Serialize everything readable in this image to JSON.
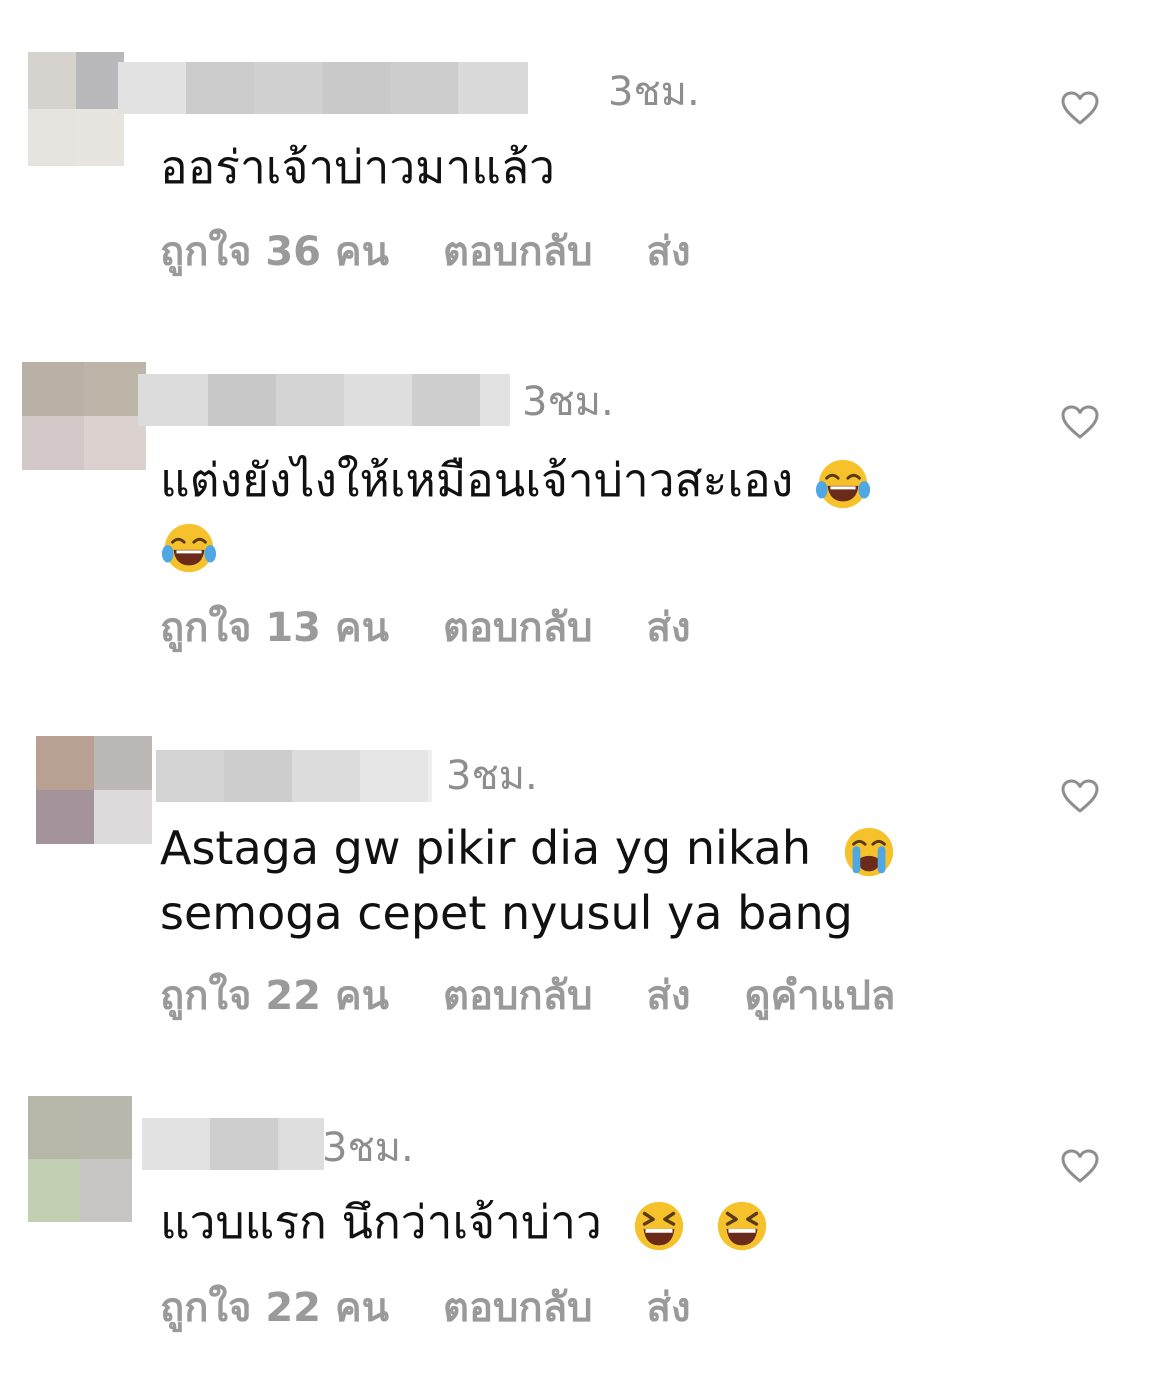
{
  "comments": [
    {
      "time": "3ชม.",
      "text": "ออร่าเจ้าบ่าวมาแล้ว",
      "likes": "ถูกใจ 36 คน",
      "reply": "ตอบกลับ",
      "send": "ส่ง",
      "emojis": []
    },
    {
      "time": "3ชม.",
      "text": "แต่งยังไงให้เหมือนเจ้าบ่าวสะเอง",
      "likes": "ถูกใจ 13 คน",
      "reply": "ตอบกลับ",
      "send": "ส่ง",
      "emojis": [
        "face-with-tears-of-joy",
        "face-with-tears-of-joy"
      ]
    },
    {
      "time": "3ชม.",
      "text": "Astaga gw pikir dia yg nikah",
      "text2": "semoga cepet nyusul ya bang",
      "likes": "ถูกใจ 22 คน",
      "reply": "ตอบกลับ",
      "send": "ส่ง",
      "translate": "ดูคำแปล",
      "emojis": [
        "loudly-crying-face"
      ]
    },
    {
      "time": "3ชม.",
      "text": "แวบแรก นึกว่าเจ้าบ่าว",
      "likes": "ถูกใจ 22 คน",
      "reply": "ตอบกลับ",
      "send": "ส่ง",
      "emojis": [
        "grinning-squinting-face",
        "grinning-squinting-face"
      ]
    }
  ],
  "icons": {
    "like": "heart-outline-icon"
  }
}
